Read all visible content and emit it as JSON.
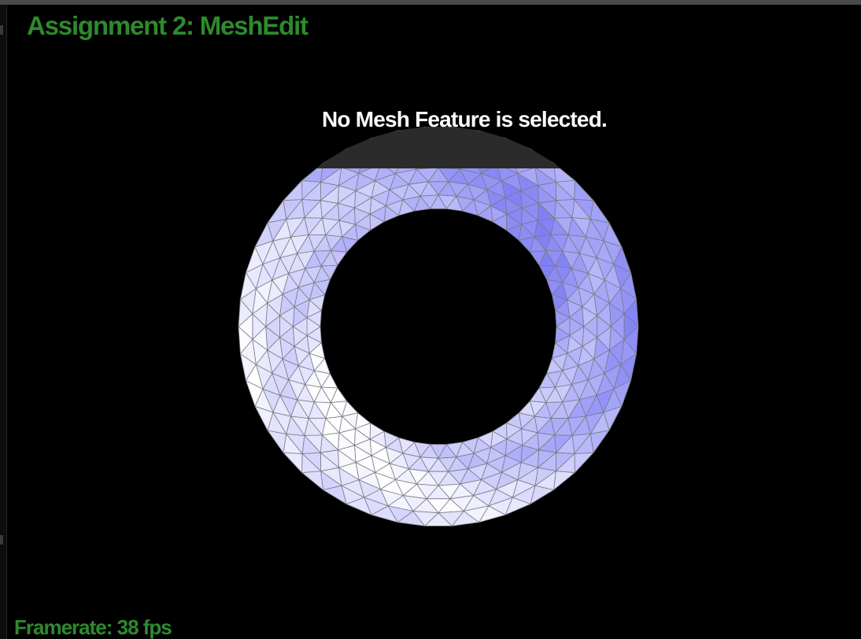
{
  "window": {
    "title": "Assignment 2: MeshEdit"
  },
  "viewport": {
    "selection_status": "No Mesh Feature is selected.",
    "framerate_text": "Framerate: 38 fps",
    "mesh": {
      "shape": "torus",
      "tessellation": "triangle",
      "base_color": "#7f7ff5",
      "highlight_color": "#ffffff",
      "edge_color": "#7a7a86"
    },
    "background_color": "#000000"
  },
  "colors": {
    "title": "#2d8a2d",
    "framerate": "#2d8a2d",
    "status_text": "#ffffff"
  }
}
